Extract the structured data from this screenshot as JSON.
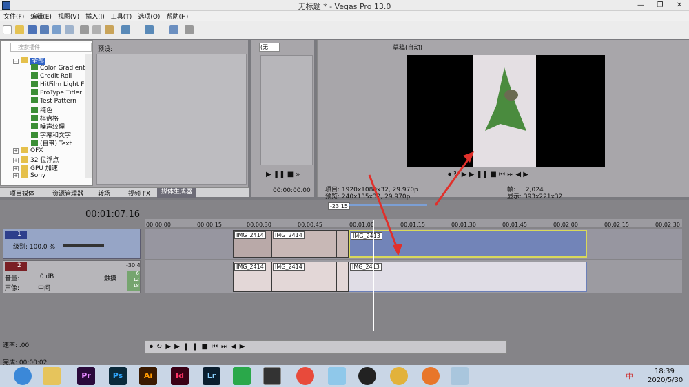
{
  "window": {
    "title": "无标题 * - Vegas Pro 13.0"
  },
  "menu": [
    "文件(F)",
    "编辑(E)",
    "视图(V)",
    "插入(I)",
    "工具(T)",
    "选项(O)",
    "帮助(H)"
  ],
  "explorer": {
    "search_placeholder": "搜索插件",
    "preset_label": "预设:",
    "tree": [
      {
        "label": "全部",
        "kind": "folder",
        "selected": true
      },
      {
        "label": "Color Gradient",
        "kind": "fx"
      },
      {
        "label": "Credit Roll",
        "kind": "fx"
      },
      {
        "label": "HitFilm Light Fla",
        "kind": "fx"
      },
      {
        "label": "ProType Titler",
        "kind": "fx"
      },
      {
        "label": "Test Pattern",
        "kind": "fx"
      },
      {
        "label": "纯色",
        "kind": "fx"
      },
      {
        "label": "棋盘格",
        "kind": "fx"
      },
      {
        "label": "噪声纹理",
        "kind": "fx"
      },
      {
        "label": "字幕和文字",
        "kind": "fx"
      },
      {
        "label": "(自带) Text",
        "kind": "fx"
      },
      {
        "label": "OFX",
        "kind": "folder"
      },
      {
        "label": "32 位浮点",
        "kind": "folder"
      },
      {
        "label": "GPU 加速",
        "kind": "folder"
      },
      {
        "label": "Sony",
        "kind": "folder"
      }
    ],
    "tabs": [
      "项目媒体",
      "资源管理器",
      "转场",
      "视频 FX",
      "媒体生成器"
    ],
    "active_tab": "媒体生成器"
  },
  "trimmer": {
    "dropdown": "(无",
    "timecode": "00:00:00.00"
  },
  "preview": {
    "quality": "草稿(自动)",
    "project_label": "项目:",
    "project_value": "1920x1080x32, 29.970p",
    "preview_label": "预览:",
    "preview_value": "240x135x32, 29.970p",
    "frame_label": "帧:",
    "frame_value": "2,024",
    "display_label": "显示:",
    "display_value": "393x221x32"
  },
  "timeline": {
    "timecode": "00:01:07.16",
    "marker_label": "-23:15",
    "ticks": [
      "00:00:00",
      "00:00:15",
      "00:00:30",
      "00:00:45",
      "00:01:00",
      "00:01:15",
      "00:01:30",
      "00:01:45",
      "00:02:00",
      "00:02:15",
      "00:02:30"
    ],
    "video_track": {
      "number": "1",
      "level_label": "级别: 100.0 %"
    },
    "audio_track": {
      "number": "2",
      "volume_label": "音量:",
      "volume_value": ".0 dB",
      "pan_label": "声像:",
      "pan_value": "中间",
      "touch_label": "触摸",
      "meter_top": "-30.4",
      "meter_vals": [
        "6",
        "12",
        "18"
      ]
    },
    "video_clips": [
      "IMG_2414",
      "IMG_2414",
      "IMG_2413"
    ],
    "audio_clips": [
      "IMG_2414",
      "IMG_2414",
      "IMG_2413"
    ],
    "rate_label": "速率: .00"
  },
  "status": {
    "complete": "完成: 00:00:02"
  },
  "taskbar": {
    "apps": [
      "Pr",
      "Ps",
      "Ai",
      "Id",
      "Lr"
    ],
    "time": "18:39",
    "date": "2020/5/30",
    "ime": "中"
  }
}
